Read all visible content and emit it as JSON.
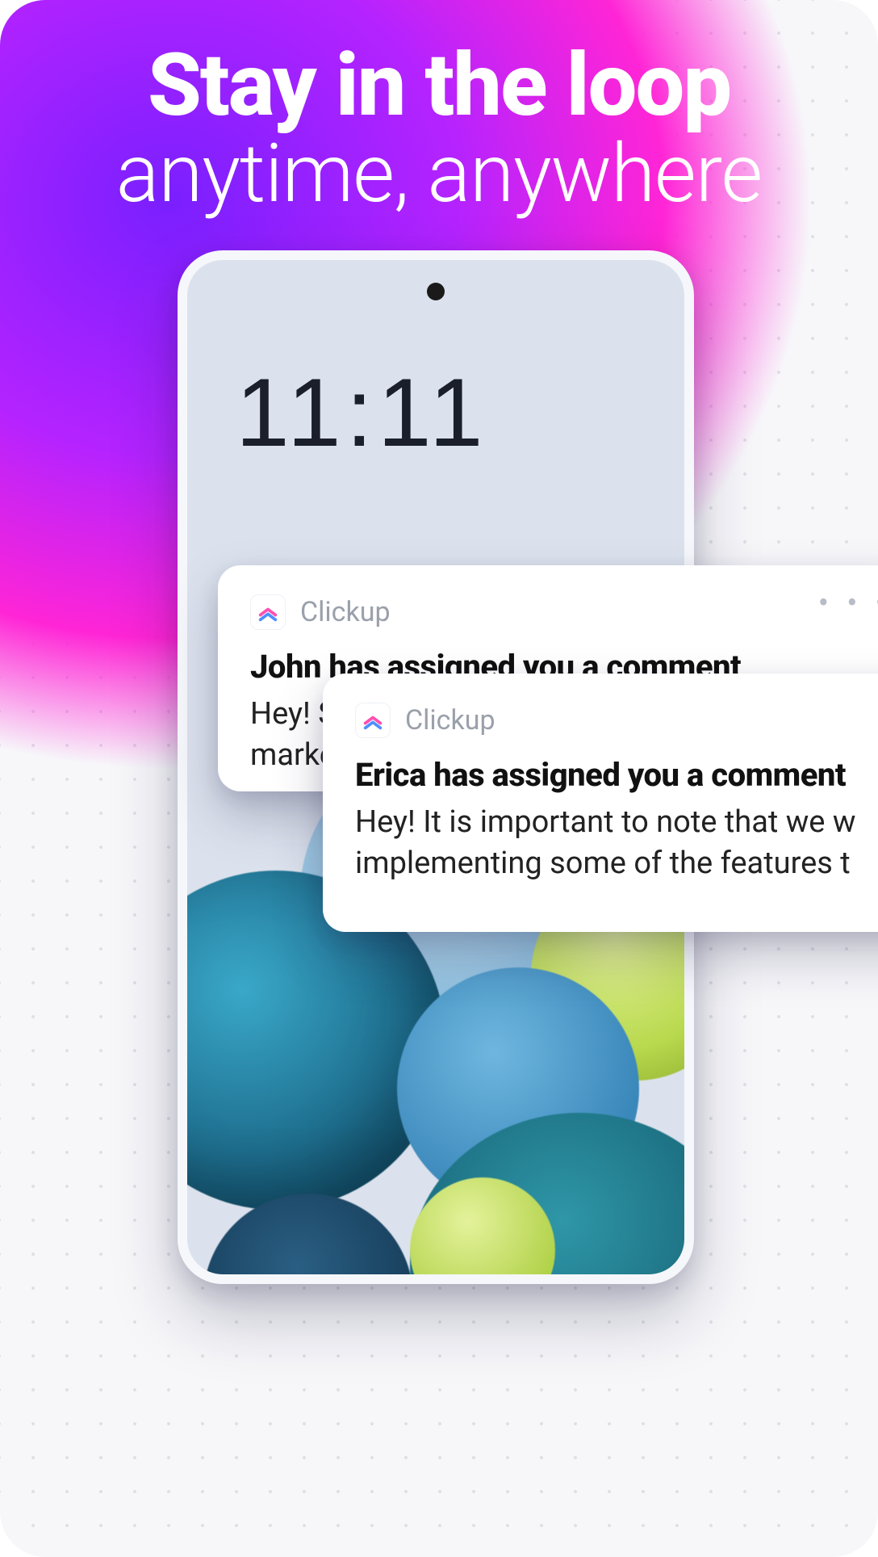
{
  "headline": {
    "line1": "Stay in the loop",
    "line2": "anytime, anywhere"
  },
  "phone": {
    "time": "11:11"
  },
  "notifications": [
    {
      "app": "Clickup",
      "title": "John has assigned you a comment",
      "body": "Hey! So y marketin",
      "more": "• • •"
    },
    {
      "app": "Clickup",
      "title": "Erica has assigned you a comment",
      "body": "Hey! It is important to note that we w implementing some of the features t"
    }
  ]
}
